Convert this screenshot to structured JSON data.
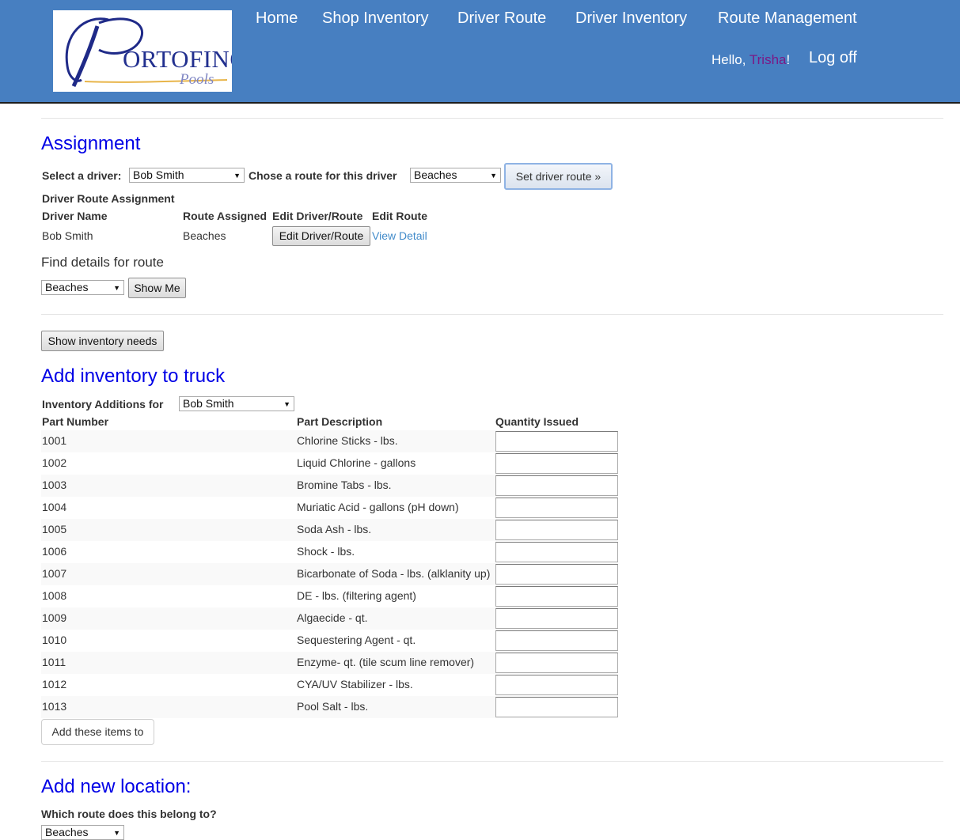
{
  "header": {
    "logo": {
      "brand": "ORTOFINO",
      "initial": "P",
      "sub": "Pools"
    },
    "nav": [
      "Home",
      "Shop Inventory",
      "Driver Route",
      "Driver Inventory",
      "Route Management"
    ],
    "greeting_prefix": "Hello, ",
    "user": "Trisha",
    "greeting_suffix": "!",
    "logoff": "Log off",
    "colors": {
      "bar": "#477fc1",
      "user": "#7a1a86"
    }
  },
  "assignment": {
    "title": "Assignment",
    "select_driver_label": "Select a driver:",
    "driver_value": "Bob Smith",
    "route_label": "Chose a route for this driver",
    "route_value": "Beaches",
    "set_button": "Set driver route »",
    "table_title": "Driver Route Assignment",
    "columns": [
      "Driver Name",
      "Route Assigned",
      "Edit Driver/Route",
      "Edit Route"
    ],
    "row": {
      "driver": "Bob Smith",
      "route": "Beaches",
      "edit_button": "Edit Driver/Route",
      "detail_link": "View Detail"
    },
    "find_label": "Find details for route",
    "find_value": "Beaches",
    "show_button": "Show Me"
  },
  "inventory": {
    "needs_button": "Show inventory needs",
    "title": "Add inventory to truck",
    "additions_label": "Inventory Additions for",
    "driver_value": "Bob Smith",
    "columns": [
      "Part Number",
      "Part Description",
      "Quantity Issued"
    ],
    "items": [
      {
        "part": "1001",
        "desc": "Chlorine Sticks - lbs."
      },
      {
        "part": "1002",
        "desc": "Liquid Chlorine - gallons"
      },
      {
        "part": "1003",
        "desc": "Bromine Tabs - lbs."
      },
      {
        "part": "1004",
        "desc": "Muriatic Acid - gallons (pH down)"
      },
      {
        "part": "1005",
        "desc": "Soda Ash - lbs."
      },
      {
        "part": "1006",
        "desc": "Shock - lbs."
      },
      {
        "part": "1007",
        "desc": "Bicarbonate of Soda - lbs. (alklanity up)"
      },
      {
        "part": "1008",
        "desc": "DE - lbs. (filtering agent)"
      },
      {
        "part": "1009",
        "desc": "Algaecide - qt."
      },
      {
        "part": "1010",
        "desc": "Sequestering Agent - qt."
      },
      {
        "part": "1011",
        "desc": "Enzyme- qt. (tile scum line remover)"
      },
      {
        "part": "1012",
        "desc": "CYA/UV Stabilizer - lbs."
      },
      {
        "part": "1013",
        "desc": "Pool Salt - lbs."
      }
    ],
    "add_button": "Add these items to"
  },
  "location": {
    "title": "Add new location:",
    "route_question": "Which route does this belong to?",
    "route_value": "Beaches"
  }
}
